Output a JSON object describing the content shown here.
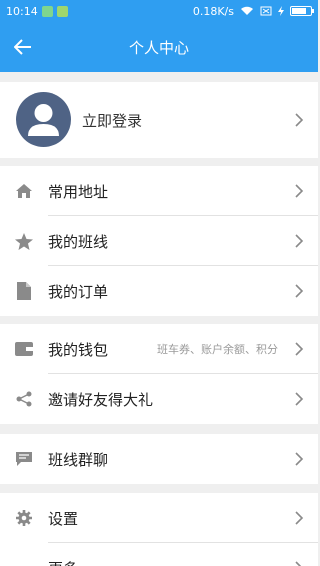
{
  "status_bar": {
    "time": "10:14",
    "speed": "0.18K/s",
    "battery_level": 0.8
  },
  "header": {
    "title": "个人中心",
    "back_icon": "arrow-left-icon"
  },
  "login": {
    "label": "立即登录",
    "avatar_icon": "user-avatar-icon"
  },
  "group1": [
    {
      "label": "常用地址",
      "icon": "home-icon"
    },
    {
      "label": "我的班线",
      "icon": "star-icon"
    },
    {
      "label": "我的订单",
      "icon": "document-icon"
    }
  ],
  "group2": [
    {
      "label": "我的钱包",
      "hint": "班车券、账户余额、积分",
      "icon": "wallet-icon"
    },
    {
      "label": "邀请好友得大礼",
      "icon": "share-icon"
    }
  ],
  "group3": [
    {
      "label": "班线群聊",
      "icon": "chat-icon"
    }
  ],
  "group4": [
    {
      "label": "设置",
      "icon": "settings-icon"
    },
    {
      "label": "更多",
      "icon": "more-icon"
    }
  ],
  "colors": {
    "primary": "#2f9ef1",
    "icon_gray": "#8a8a8a",
    "avatar_bg": "#4f6385"
  }
}
